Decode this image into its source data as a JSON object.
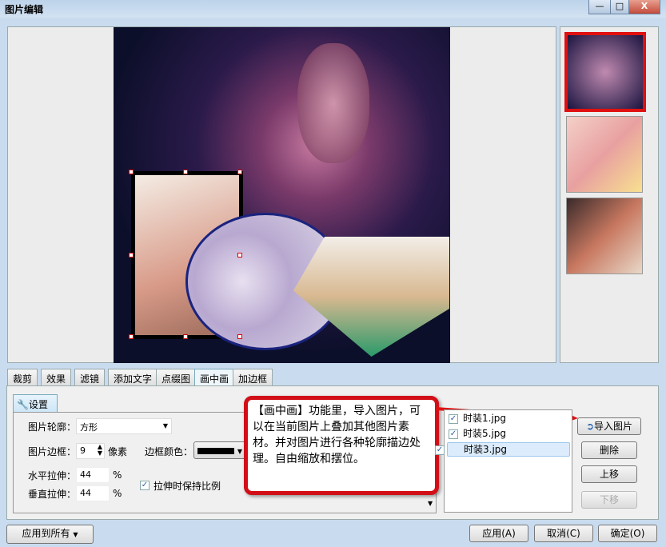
{
  "window": {
    "title": "图片编辑",
    "minimize": "—",
    "maximize": "□",
    "close": "X"
  },
  "tabs": [
    "裁剪",
    "效果",
    "滤镜",
    "添加文字",
    "点缀图",
    "画中画",
    "加边框"
  ],
  "active_tab": "画中画",
  "settings": {
    "tab_label": "设置",
    "outline_label": "图片轮廓：",
    "outline_value": "方形",
    "border_label": "图片边框：",
    "border_value": "9",
    "border_unit": "像素",
    "border_color_label": "边框颜色：",
    "border_color": "#000000",
    "h_stretch_label": "水平拉伸：",
    "h_stretch_value": "44",
    "h_unit": "%",
    "v_stretch_label": "垂直拉伸：",
    "v_stretch_value": "44",
    "v_unit": "%",
    "keep_ratio_label": "拉伸时保持比例",
    "keep_ratio_checked": true
  },
  "callout": {
    "text": "【画中画】功能里，导入图片，可以在当前图片上叠加其他图片素材。并对图片进行各种轮廓描边处理。自由缩放和摆位。"
  },
  "files": [
    {
      "name": "时装1.jpg",
      "checked": true
    },
    {
      "name": "时装5.jpg",
      "checked": true
    },
    {
      "name": "时装3.jpg",
      "checked": true,
      "selected": true
    }
  ],
  "buttons": {
    "import": "导入图片",
    "delete": "删除",
    "up": "上移",
    "down": "下移",
    "apply_all": "应用到所有",
    "apply": "应用(A)",
    "cancel": "取消(C)",
    "ok": "确定(O)"
  },
  "colors": {
    "accent": "#d20f17"
  }
}
